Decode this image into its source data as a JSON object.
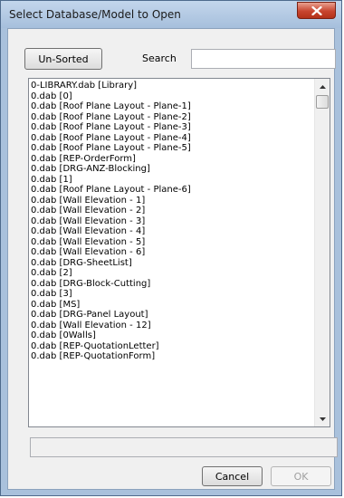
{
  "window": {
    "title": "Select Database/Model to Open"
  },
  "toolbar": {
    "sort_button_label": "Un-Sorted",
    "search_label": "Search",
    "search_value": ""
  },
  "list": {
    "items": [
      "0-LIBRARY.dab [Library]",
      "0.dab [0]",
      "0.dab [Roof Plane Layout - Plane-1]",
      "0.dab [Roof Plane Layout - Plane-2]",
      "0.dab [Roof Plane Layout - Plane-3]",
      "0.dab [Roof Plane Layout - Plane-4]",
      "0.dab [Roof Plane Layout - Plane-5]",
      "0.dab [REP-OrderForm]",
      "0.dab [DRG-ANZ-Blocking]",
      "0.dab [1]",
      "0.dab [Roof Plane Layout - Plane-6]",
      "0.dab [Wall Elevation - 1]",
      "0.dab [Wall Elevation - 2]",
      "0.dab [Wall Elevation - 3]",
      "0.dab [Wall Elevation - 4]",
      "0.dab [Wall Elevation - 5]",
      "0.dab [Wall Elevation - 6]",
      "0.dab [DRG-SheetList]",
      "0.dab [2]",
      "0.dab [DRG-Block-Cutting]",
      "0.dab [3]",
      "0.dab [MS]",
      "0.dab [DRG-Panel Layout]",
      "0.dab [Wall Elevation - 12]",
      "0.dab [0Walls]",
      "0.dab [REP-QuotationLetter]",
      "0.dab [REP-QuotationForm]"
    ]
  },
  "status": {
    "value": ""
  },
  "footer": {
    "cancel_label": "Cancel",
    "ok_label": "OK"
  }
}
